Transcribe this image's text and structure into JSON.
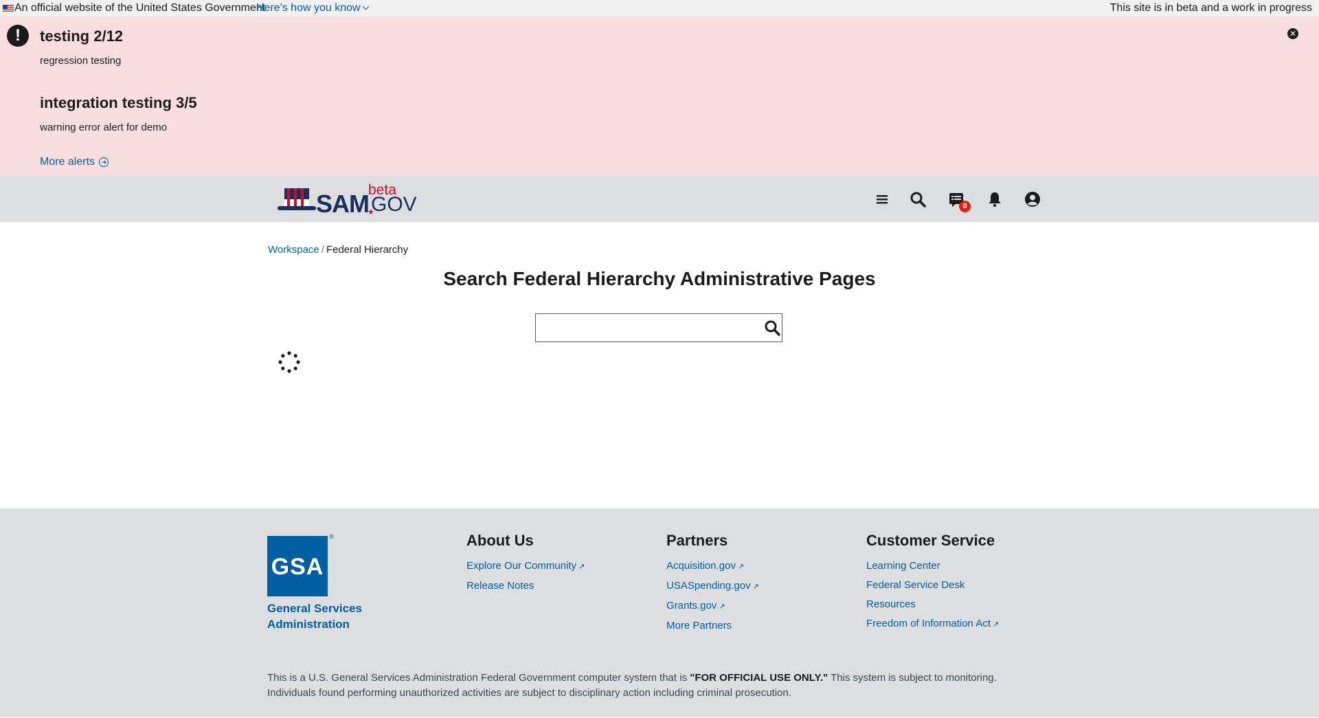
{
  "gov_banner": {
    "official_text": "An official website of the United States Government",
    "how_you_know": "Here's how you know",
    "beta_text": "This site is in beta and a work in progress"
  },
  "alerts": {
    "items": [
      {
        "title": "testing 2/12",
        "body": "regression testing"
      },
      {
        "title": "integration testing 3/5",
        "body": "warning error alert for demo"
      }
    ],
    "more_label": "More alerts",
    "close_icon": "close-icon"
  },
  "header": {
    "logo": {
      "sam": "SAM",
      "beta": "beta",
      "gov": "GOV"
    },
    "notification_count": "0",
    "icons": [
      "menu-icon",
      "search-icon",
      "messages-icon",
      "bell-icon",
      "user-icon"
    ]
  },
  "breadcrumb": {
    "items": [
      {
        "label": "Workspace"
      },
      {
        "label": "Federal Hierarchy"
      }
    ],
    "separator": "/"
  },
  "main": {
    "title": "Search Federal Hierarchy Administrative Pages",
    "search": {
      "value": "",
      "placeholder": ""
    }
  },
  "footer": {
    "gsa_logo_text": "GSA",
    "gsa_name": [
      "General Services",
      "Administration"
    ],
    "columns": [
      {
        "heading": "About Us",
        "links": [
          {
            "label": "Explore Our Community",
            "external": true
          },
          {
            "label": "Release Notes",
            "external": false
          }
        ]
      },
      {
        "heading": "Partners",
        "links": [
          {
            "label": "Acquisition.gov",
            "external": true
          },
          {
            "label": "USASpending.gov",
            "external": true
          },
          {
            "label": "Grants.gov",
            "external": true
          },
          {
            "label": "More Partners",
            "external": false
          }
        ]
      },
      {
        "heading": "Customer Service",
        "links": [
          {
            "label": "Learning Center",
            "external": false
          },
          {
            "label": "Federal Service Desk",
            "external": false
          },
          {
            "label": "Resources",
            "external": false
          },
          {
            "label": "Freedom of Information Act",
            "external": true
          }
        ]
      }
    ],
    "disclaimer": {
      "before": "This is a U.S. General Services Administration Federal Government computer system that is ",
      "emphasis": "\"FOR OFFICIAL USE ONLY.\"",
      "after": " This system is subject to monitoring. Individuals found performing unauthorized activities are subject to disciplinary action including criminal prosecution."
    }
  },
  "colors": {
    "link": "#005ea2",
    "alert_bg": "#f9dee0",
    "header_bg": "#dcdee0",
    "badge": "#e52207"
  }
}
